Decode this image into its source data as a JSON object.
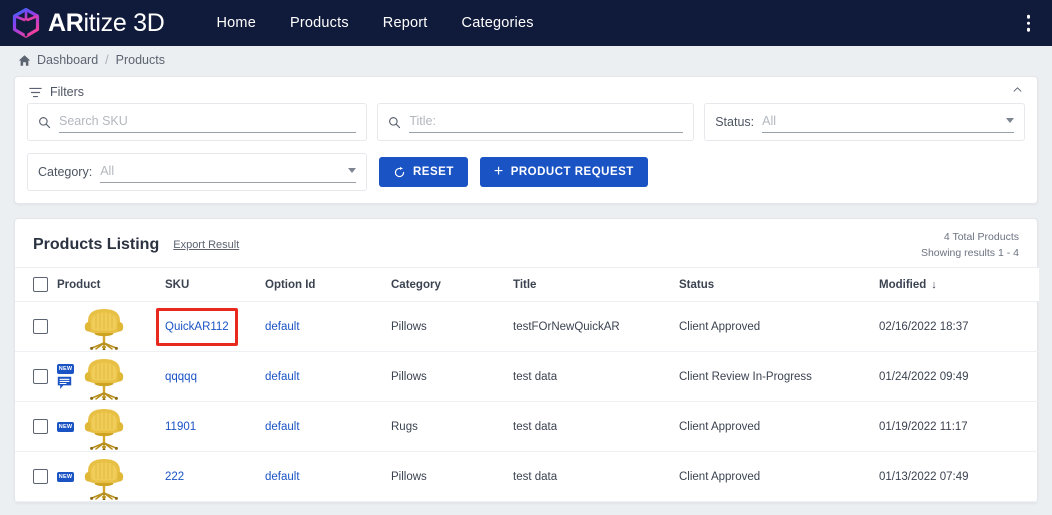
{
  "brand": {
    "name_prefix": "AR",
    "name_suffix": "itize 3D",
    "logo_icon": "cube-3d-icon",
    "colors": {
      "nav_bg": "#101a3a",
      "accent": "#1a53c4",
      "highlight": "#e8291d"
    }
  },
  "nav": {
    "items": [
      {
        "label": "Home",
        "name": "nav-link-home"
      },
      {
        "label": "Products",
        "name": "nav-link-products"
      },
      {
        "label": "Report",
        "name": "nav-link-report"
      },
      {
        "label": "Categories",
        "name": "nav-link-categories"
      }
    ],
    "kebab_icon": "more-vertical-icon"
  },
  "breadcrumb": {
    "home_icon": "home-icon",
    "root": "Dashboard",
    "separator": "/",
    "current": "Products"
  },
  "filters": {
    "icon": "filter-icon",
    "title": "Filters",
    "collapse_icon": "chevron-up-icon",
    "sku": {
      "placeholder": "Search SKU",
      "value": "",
      "icon": "search-icon"
    },
    "title_field": {
      "placeholder": "Title:",
      "value": "",
      "icon": "search-icon"
    },
    "status": {
      "label": "Status:",
      "value": "All",
      "caret_icon": "chevron-down-icon"
    },
    "category": {
      "label": "Category:",
      "value": "All",
      "caret_icon": "chevron-down-icon"
    },
    "reset_button": {
      "label": "RESET",
      "icon": "refresh-icon"
    },
    "request_button": {
      "label": "PRODUCT REQUEST",
      "icon": "plus-icon"
    }
  },
  "listing": {
    "title": "Products Listing",
    "export_label": "Export Result",
    "total_text": "4 Total Products",
    "showing_text": "Showing results 1 - 4",
    "columns": [
      {
        "key": "checkbox",
        "label": ""
      },
      {
        "key": "product",
        "label": "Product"
      },
      {
        "key": "sku",
        "label": "SKU"
      },
      {
        "key": "option_id",
        "label": "Option Id"
      },
      {
        "key": "category",
        "label": "Category"
      },
      {
        "key": "title",
        "label": "Title"
      },
      {
        "key": "status",
        "label": "Status"
      },
      {
        "key": "modified",
        "label": "Modified"
      }
    ],
    "sort": {
      "column": "Modified",
      "direction_icon": "arrow-down-icon",
      "glyph": "↓"
    },
    "rows": [
      {
        "is_new": false,
        "has_comment": false,
        "sku": "QuickAR112",
        "sku_highlighted": true,
        "option_id": "default",
        "category": "Pillows",
        "title": "testFOrNewQuickAR",
        "status": "Client Approved",
        "modified": "02/16/2022 18:37"
      },
      {
        "is_new": true,
        "has_comment": true,
        "sku": "qqqqq",
        "sku_highlighted": false,
        "option_id": "default",
        "category": "Pillows",
        "title": "test data",
        "status": "Client Review In-Progress",
        "modified": "01/24/2022 09:49"
      },
      {
        "is_new": true,
        "has_comment": false,
        "sku": "11901",
        "sku_highlighted": false,
        "option_id": "default",
        "category": "Rugs",
        "title": "test data",
        "status": "Client Approved",
        "modified": "01/19/2022 11:17"
      },
      {
        "is_new": true,
        "has_comment": false,
        "sku": "222",
        "sku_highlighted": false,
        "option_id": "default",
        "category": "Pillows",
        "title": "test data",
        "status": "Client Approved",
        "modified": "01/13/2022 07:49"
      }
    ],
    "new_badge_label": "NEW",
    "thumbnail_icon": "yellow-armchair-thumbnail",
    "comment_icon": "comment-icon"
  }
}
